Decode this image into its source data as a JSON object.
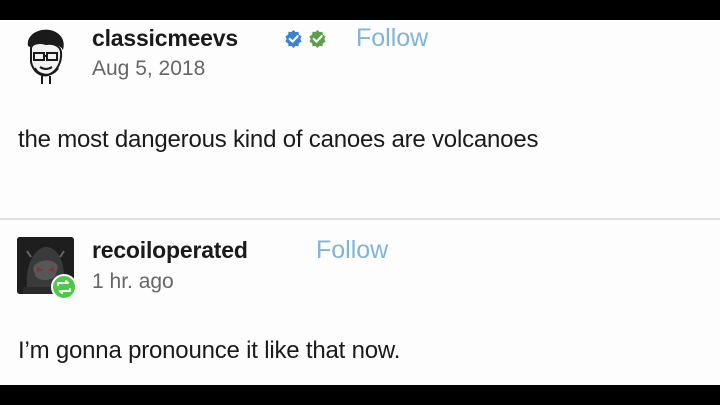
{
  "colors": {
    "follow": "#7fb5da",
    "text": "#1a1a1a",
    "meta": "#666666",
    "verified_blue": "#3b82d6",
    "verified_green": "#5aa04a",
    "reblog_green": "#4ec94a"
  },
  "post_1": {
    "username": "classicmeevs",
    "follow_label": "Follow",
    "date": "Aug 5, 2018",
    "text": "the most dangerous kind of canoes are volcanoes",
    "badges": [
      "verified-blue-icon",
      "verified-green-icon"
    ]
  },
  "post_2": {
    "username": "recoiloperated",
    "follow_label": "Follow",
    "time": "1 hr. ago",
    "text": "I’m gonna pronounce it like that now.",
    "badge": "reblog-icon"
  }
}
